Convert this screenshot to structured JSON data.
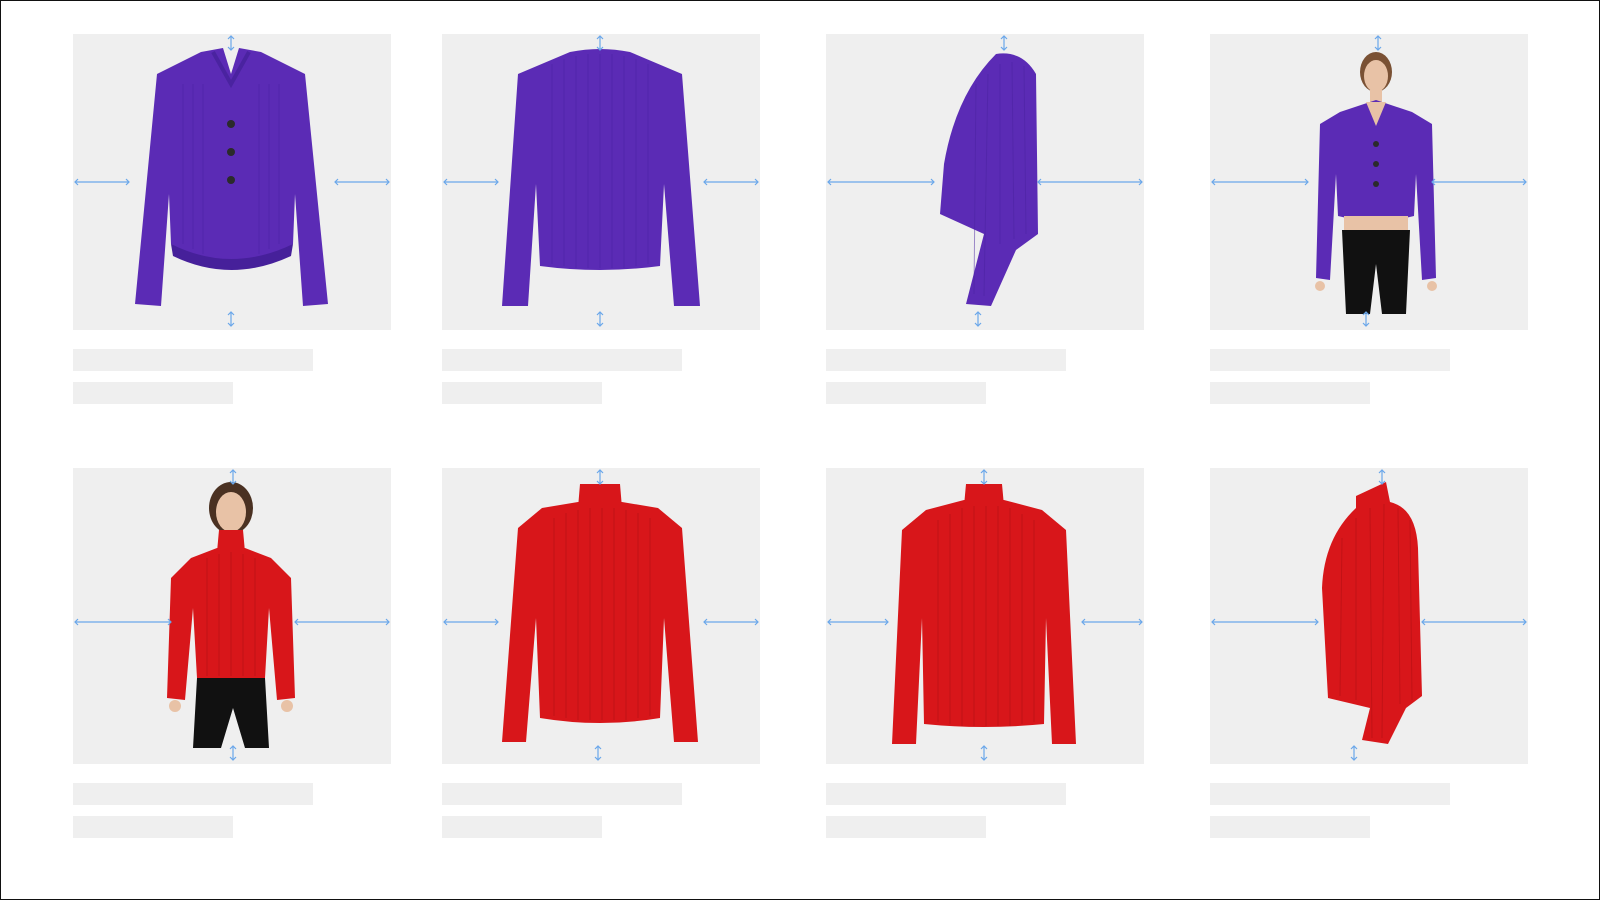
{
  "products": [
    {
      "id": "purple-cardigan-front",
      "color": "#5b2bb5",
      "view": "front-cardigan",
      "zoom_control": "crop-guides"
    },
    {
      "id": "purple-cardigan-back",
      "color": "#5b2bb5",
      "view": "back-sweater",
      "zoom_control": "crop-guides"
    },
    {
      "id": "purple-cardigan-side",
      "color": "#5b2bb5",
      "view": "side",
      "zoom_control": "crop-guides"
    },
    {
      "id": "purple-cardigan-model",
      "color": "#5b2bb5",
      "view": "model-cardigan",
      "zoom_control": "crop-guides"
    },
    {
      "id": "red-sweater-model",
      "color": "#d8161a",
      "view": "model-sweater",
      "zoom_control": "crop-guides"
    },
    {
      "id": "red-sweater-front",
      "color": "#d8161a",
      "view": "front-turtleneck",
      "zoom_control": "crop-guides"
    },
    {
      "id": "red-sweater-back",
      "color": "#d8161a",
      "view": "back-turtleneck",
      "zoom_control": "crop-guides"
    },
    {
      "id": "red-sweater-side",
      "color": "#d8161a",
      "view": "side-turtleneck",
      "zoom_control": "crop-guides"
    }
  ],
  "guide_color": "#6aa7ea",
  "placeholder_color": "#efefef"
}
